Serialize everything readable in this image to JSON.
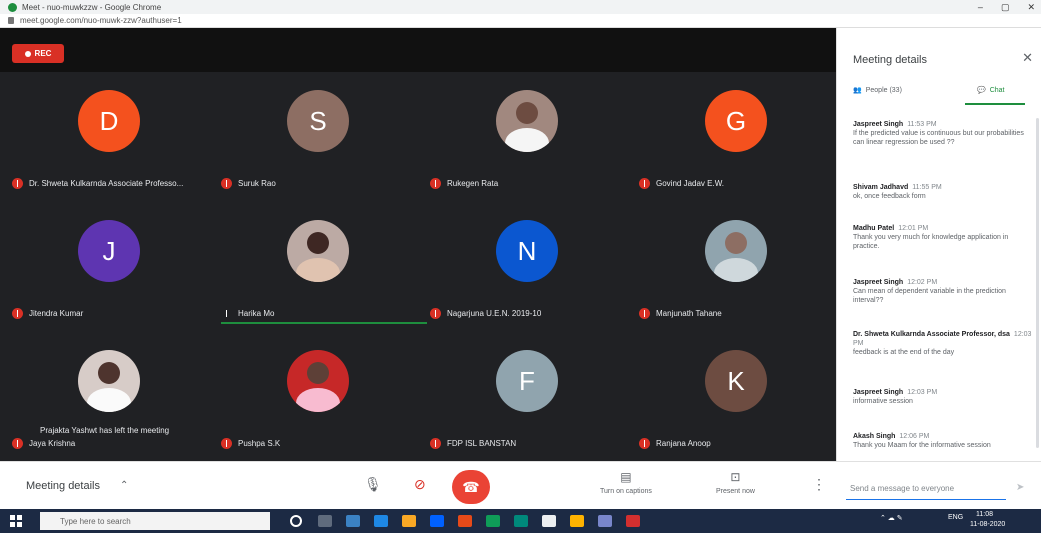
{
  "browser": {
    "tab_title": "Meet - nuo-muwkzzw - Google Chrome",
    "url": "meet.google.com/nuo-muwk-zzw?authuser=1",
    "window_controls": [
      "–",
      "▢",
      "✕"
    ]
  },
  "recording": {
    "label": "REC"
  },
  "participants": [
    {
      "initial": "D",
      "name": "Dr. Shweta Kulkarnda Associate Professo...",
      "color": "#f4511e",
      "photo": false
    },
    {
      "initial": "S",
      "name": "Suruk Rao",
      "color": "#8d6e63",
      "photo": false
    },
    {
      "initial": "",
      "name": "Rukegen Rata",
      "color": "#a1887f",
      "photo": true,
      "photo_head": "#6d4c41",
      "photo_body": "#f5f5f5"
    },
    {
      "initial": "G",
      "name": "Govind Jadav E.W.",
      "color": "#f4511e",
      "photo": false
    },
    {
      "initial": "J",
      "name": "Jitendra Kumar",
      "color": "#5e35b1",
      "photo": false
    },
    {
      "initial": "",
      "name": "Harika Mo",
      "color": "#bcaaa4",
      "photo": true,
      "photo_head": "#3e2723",
      "photo_body": "#e0c3b0",
      "speaking": true
    },
    {
      "initial": "N",
      "name": "Nagarjuna U.E.N. 2019-10",
      "color": "#0b57d0",
      "photo": false
    },
    {
      "initial": "",
      "name": "Manjunath Tahane",
      "color": "#90a4ae",
      "photo": true,
      "photo_head": "#8d6e63",
      "photo_body": "#cfd8dc"
    },
    {
      "initial": "",
      "name": "Jaya Krishna",
      "color": "#d7ccc8",
      "photo": true,
      "photo_head": "#4e342e",
      "photo_body": "#fafafa"
    },
    {
      "initial": "",
      "name": "Pushpa S.K",
      "color": "#c62828",
      "photo": true,
      "photo_head": "#5d4037",
      "photo_body": "#f8bbd0"
    },
    {
      "initial": "F",
      "name": "FDP ISL BANSTAN",
      "color": "#90a4ae",
      "photo": false
    },
    {
      "initial": "K",
      "name": "Ranjana Anoop",
      "color": "#6d4c41",
      "photo": false
    }
  ],
  "notice": "Prajakta Yashwt has left the meeting",
  "controls": {
    "meeting_details": "Meeting details",
    "caret": "⌃",
    "mic_icon": "🎙",
    "hangup_icon": "☎",
    "captions_label": "Turn on captions",
    "captions_icon": "▤",
    "present_label": "Present now",
    "present_icon": "⊡",
    "more_icon": "⋮",
    "chat_placeholder": "Send a message to everyone",
    "send_icon": "➤"
  },
  "panel": {
    "title": "Meeting details",
    "close": "✕",
    "tabs": [
      {
        "label": "People (33)",
        "icon": "👥",
        "active": false
      },
      {
        "label": "Chat",
        "icon": "💬",
        "active": true
      }
    ],
    "messages": [
      {
        "sender": "Jaspreet Singh",
        "time": "11:53 PM",
        "text": "If the predicted value is continuous but our probabilities can linear regression be used ??"
      },
      {
        "sender": "Shivam Jadhavd",
        "time": "11:55 PM",
        "text": "ok, once feedback form"
      },
      {
        "sender": "Madhu Patel",
        "time": "12:01 PM",
        "text": "Thank you very much for knowledge application in practice."
      },
      {
        "sender": "Jaspreet Singh",
        "time": "12:02 PM",
        "text": "Can mean of dependent variable in the prediction interval??"
      },
      {
        "sender": "Dr. Shweta Kulkarnda Associate Professor, dsa",
        "time": "12:03 PM",
        "text": "feedback is at the end of the day"
      },
      {
        "sender": "Jaspreet Singh",
        "time": "12:03 PM",
        "text": "informative session"
      },
      {
        "sender": "Akash Singh",
        "time": "12:06 PM",
        "text": "Thank you Maam for the informative session"
      }
    ]
  },
  "taskbar": {
    "search_placeholder": "Type here to search",
    "clock_time": "11:08",
    "clock_date": "11-08-2020",
    "lang": "ENG"
  }
}
